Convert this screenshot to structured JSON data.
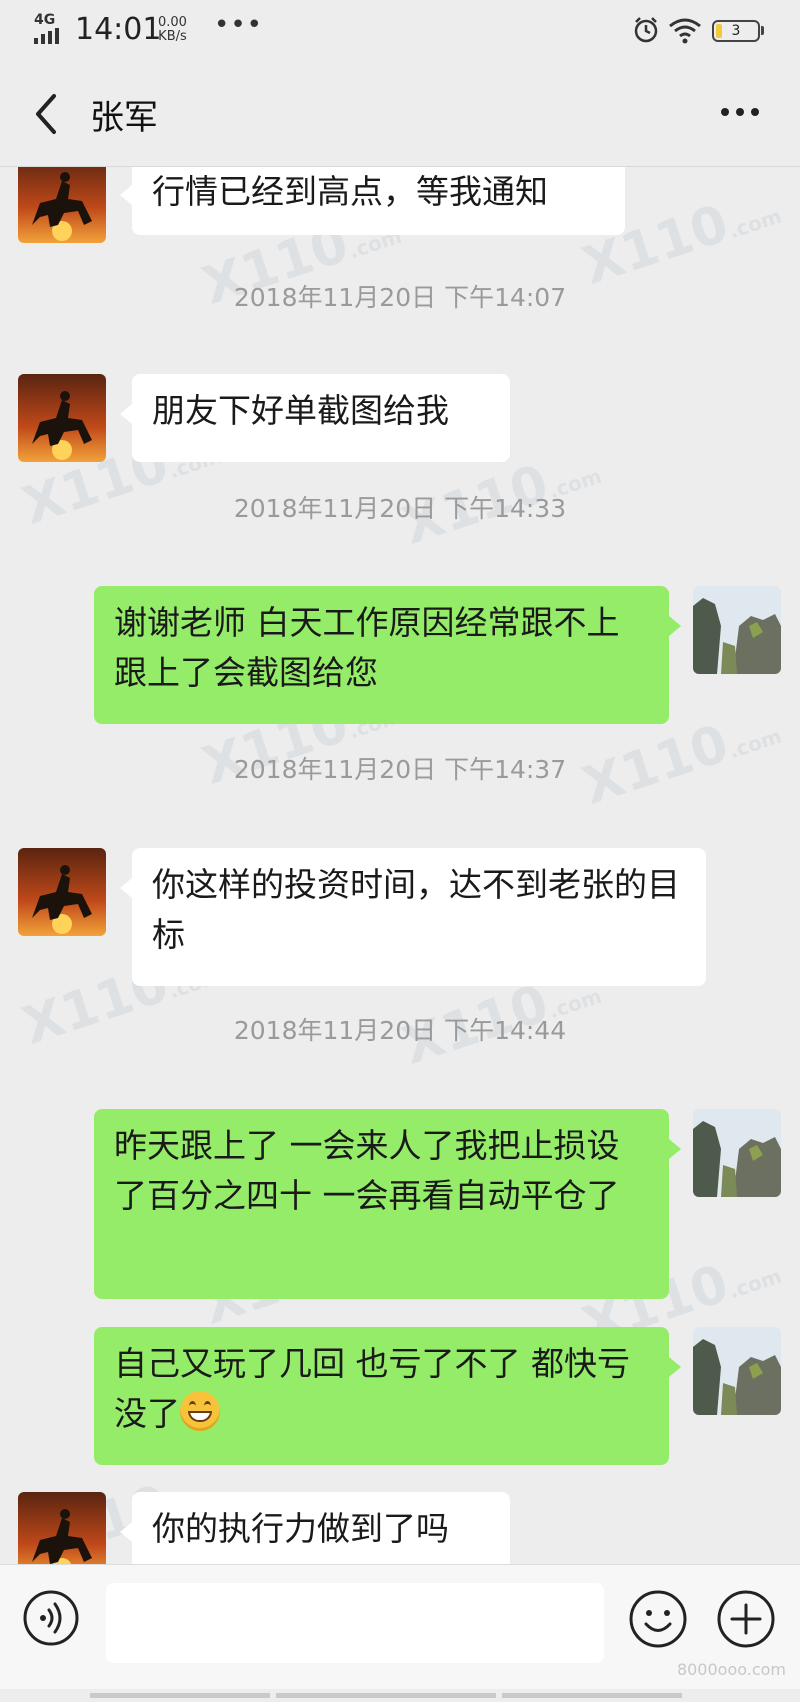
{
  "status_bar": {
    "network": "4G",
    "time": "14:01",
    "speed_value": "0.00",
    "speed_unit": "KB/s",
    "battery": "3"
  },
  "header": {
    "title": "张军"
  },
  "messages": [
    {
      "type": "incoming",
      "text": "行情已经到高点，等我通知"
    },
    {
      "type": "timestamp",
      "text": "2018年11月20日 下午14:07"
    },
    {
      "type": "incoming",
      "text": "朋友下好单截图给我"
    },
    {
      "type": "timestamp",
      "text": "2018年11月20日 下午14:33"
    },
    {
      "type": "outgoing",
      "text": "谢谢老师 白天工作原因经常跟不上跟上了会截图给您"
    },
    {
      "type": "timestamp",
      "text": "2018年11月20日 下午14:37"
    },
    {
      "type": "incoming",
      "text": "你这样的投资时间，达不到老张的目标"
    },
    {
      "type": "timestamp",
      "text": "2018年11月20日 下午14:44"
    },
    {
      "type": "outgoing",
      "text": "昨天跟上了 一会来人了我把止损设了百分之四十 一会再看自动平仓了"
    },
    {
      "type": "outgoing",
      "text": "自己又玩了几回 也亏了不了 都快亏没了",
      "emoji": "grinning-face"
    },
    {
      "type": "incoming",
      "text": "你的执行力做到了吗"
    }
  ],
  "watermark": {
    "text": "110",
    "suffix": ".com"
  },
  "input": {
    "value": ""
  },
  "footer": {
    "site": "8000ooo.com"
  },
  "colors": {
    "background": "#ededed",
    "outgoing_bubble": "#95ec69",
    "incoming_bubble": "#ffffff",
    "timestamp_text": "#9a9a9a"
  }
}
